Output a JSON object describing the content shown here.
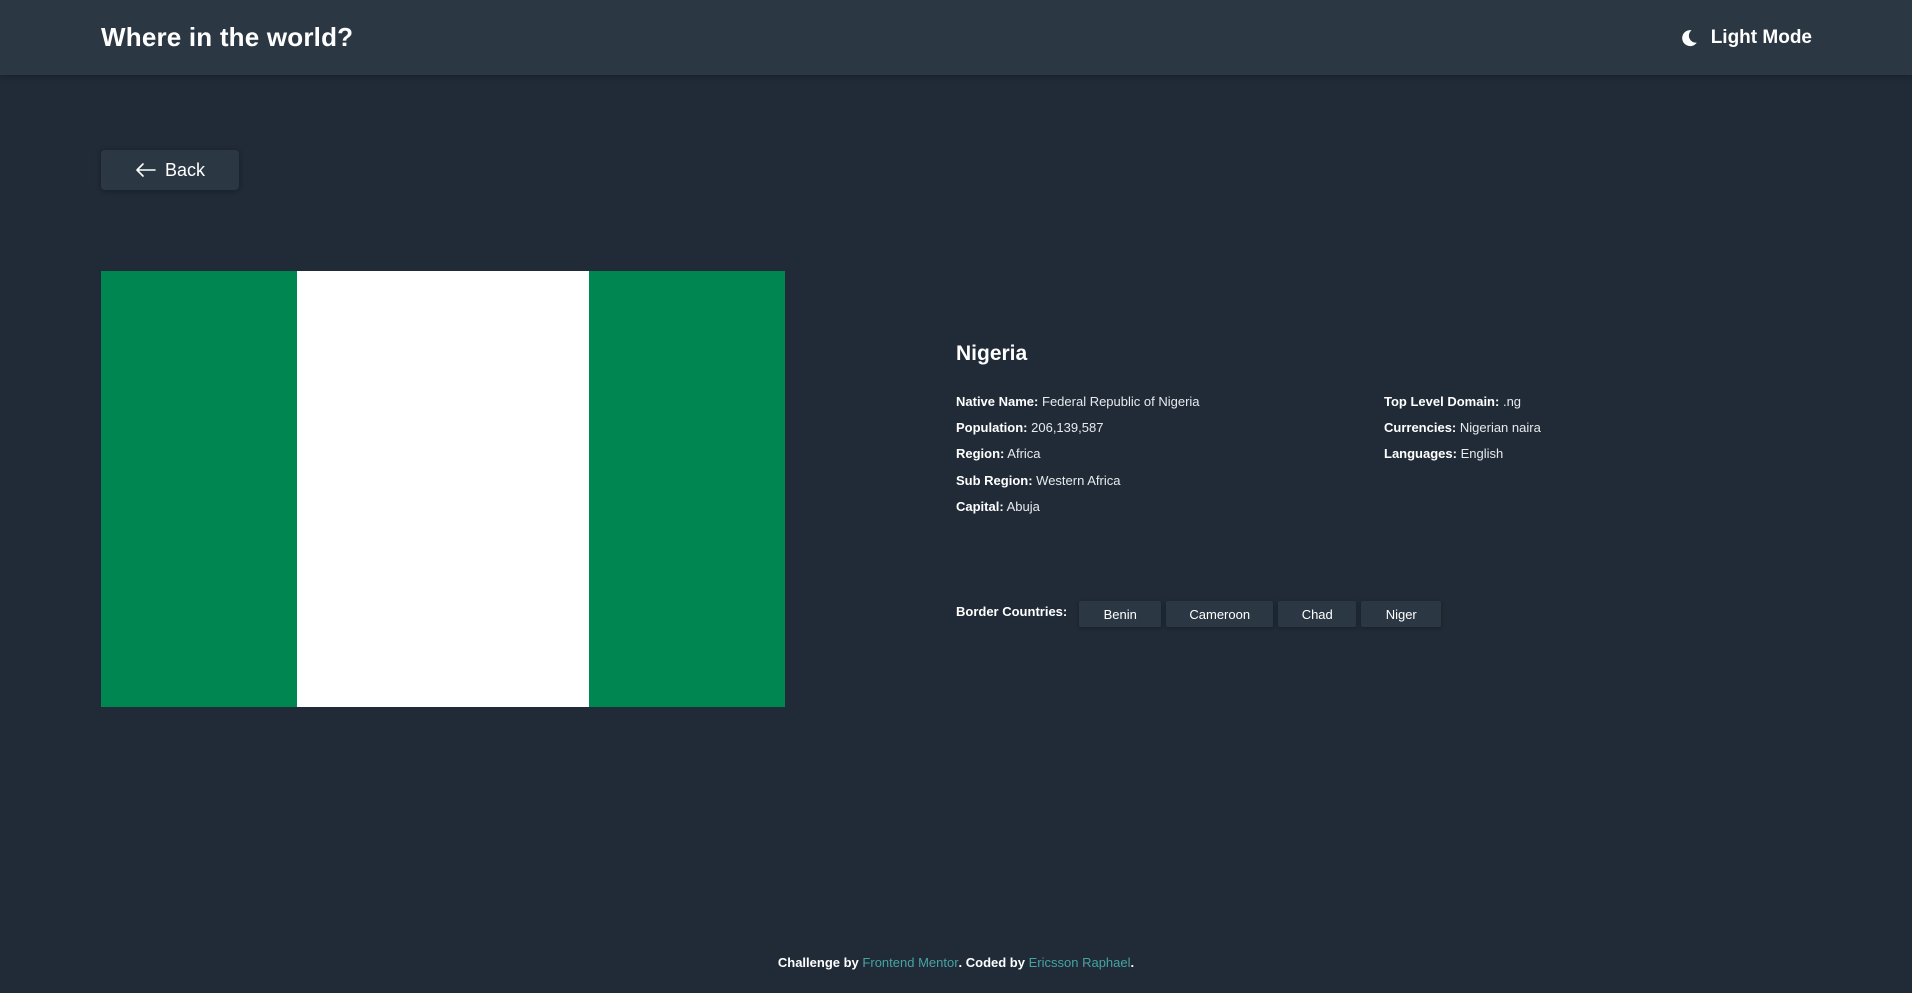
{
  "header": {
    "title": "Where in the world?",
    "theme_toggle_label": "Light Mode",
    "theme_icon": "moon-icon"
  },
  "back_button": {
    "label": "Back",
    "icon": "arrow-left-icon"
  },
  "country": {
    "name": "Nigeria",
    "flag_colors": [
      "#008751",
      "#ffffff",
      "#008751"
    ],
    "details_left": [
      {
        "label": "Native Name:",
        "value": "Federal Republic of Nigeria"
      },
      {
        "label": "Population:",
        "value": "206,139,587"
      },
      {
        "label": "Region:",
        "value": "Africa"
      },
      {
        "label": "Sub Region:",
        "value": "Western Africa"
      },
      {
        "label": "Capital:",
        "value": "Abuja"
      }
    ],
    "details_right": [
      {
        "label": "Top Level Domain:",
        "value": ".ng"
      },
      {
        "label": "Currencies:",
        "value": "Nigerian naira"
      },
      {
        "label": "Languages:",
        "value": "English"
      }
    ],
    "border_countries_label": "Border Countries:",
    "border_countries": [
      "Benin",
      "Cameroon",
      "Chad",
      "Niger"
    ]
  },
  "footer": {
    "prefix": "Challenge by",
    "link1": "Frontend Mentor",
    "middle": ". Coded by",
    "link2": "Ericsson Raphael",
    "suffix": "."
  },
  "colors": {
    "background": "#202b37",
    "element": "#2b3743",
    "link": "#47a3a3"
  }
}
